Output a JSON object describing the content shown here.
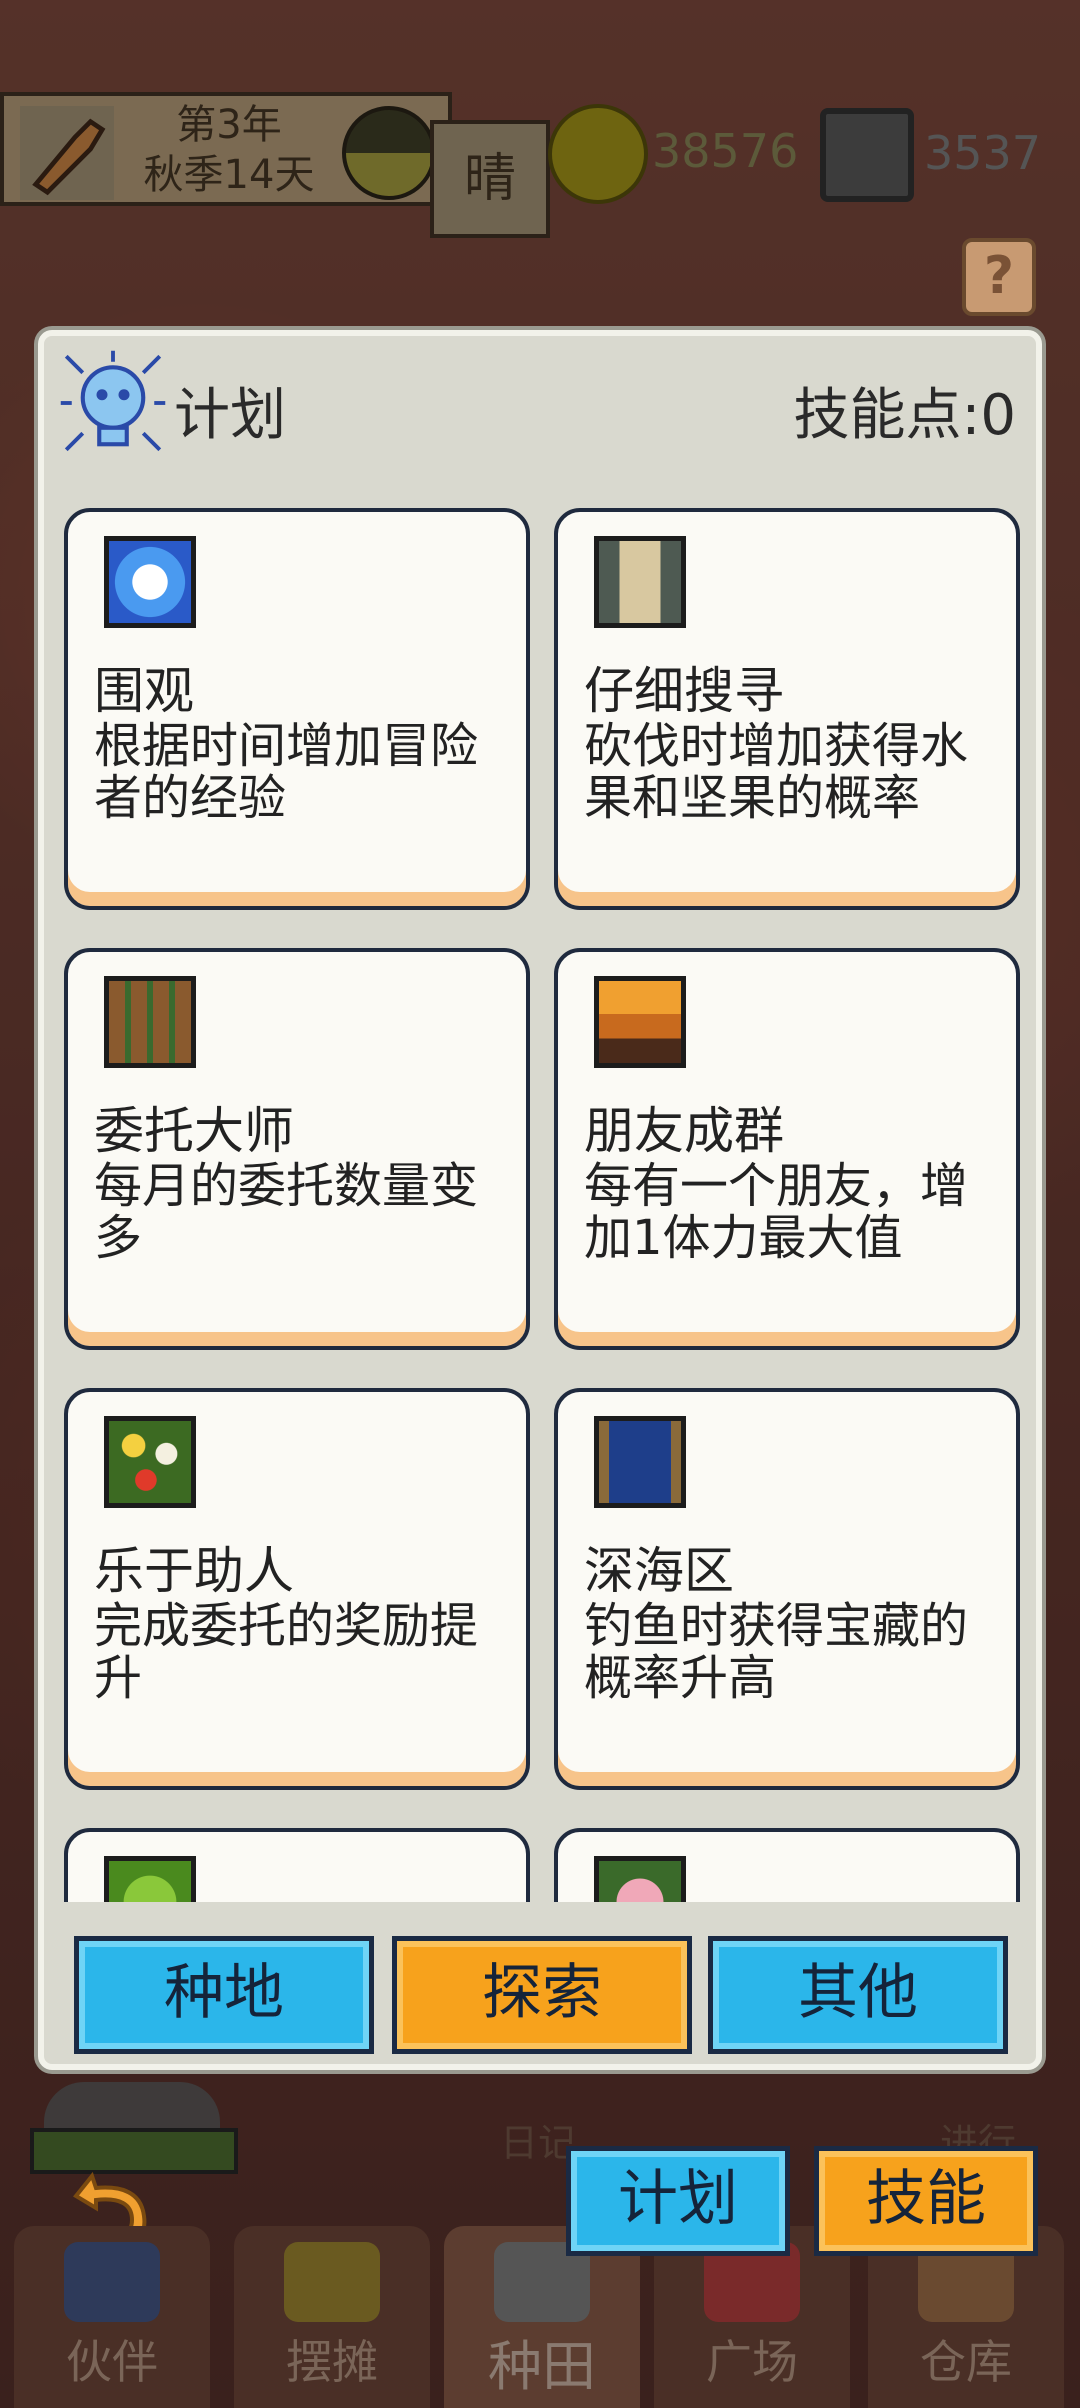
{
  "hud": {
    "date_line1": "第3年",
    "date_line2": "秋季14天",
    "weather": "晴",
    "coins": "38576",
    "gems": "3537",
    "help": "?"
  },
  "panel": {
    "title": "计划",
    "skill_points": "技能点:0",
    "cards": [
      {
        "name": "围观",
        "desc": "根据时间增加冒险者的经验",
        "icon": "sparkle-icon",
        "icon_color": "#2a6ad8"
      },
      {
        "name": "仔细搜寻",
        "desc": "砍伐时增加获得水果和坚果的概率",
        "icon": "scroll-icon",
        "icon_color": "#4e5a52"
      },
      {
        "name": "委托大师",
        "desc": "每月的委托数量变多",
        "icon": "board-icon",
        "icon_color": "#8a5a2e"
      },
      {
        "name": "朋友成群",
        "desc": "每有一个朋友，增加1体力最大值",
        "icon": "sunset-tree-icon",
        "icon_color": "#c86a1e"
      },
      {
        "name": "乐于助人",
        "desc": "完成委托的奖励提升",
        "icon": "flowers-icon",
        "icon_color": "#3c6a22"
      },
      {
        "name": "深海区",
        "desc": "钓鱼时获得宝藏的概率升高",
        "icon": "banner-icon",
        "icon_color": "#1e3e8a"
      },
      {
        "name": "",
        "desc": "",
        "icon": "leaf-icon",
        "icon_color": "#4a8a1e"
      },
      {
        "name": "",
        "desc": "",
        "icon": "rose-icon",
        "icon_color": "#d87890"
      }
    ],
    "tabs": [
      {
        "label": "种地",
        "color": "blue"
      },
      {
        "label": "探索",
        "color": "orange"
      },
      {
        "label": "其他",
        "color": "blue"
      }
    ]
  },
  "bottom": {
    "diary": "日记",
    "progress": "进行",
    "plan_button": "计划",
    "skill_button": "技能",
    "nav": [
      "伙伴",
      "摆摊",
      "种田",
      "广场",
      "仓库"
    ]
  }
}
